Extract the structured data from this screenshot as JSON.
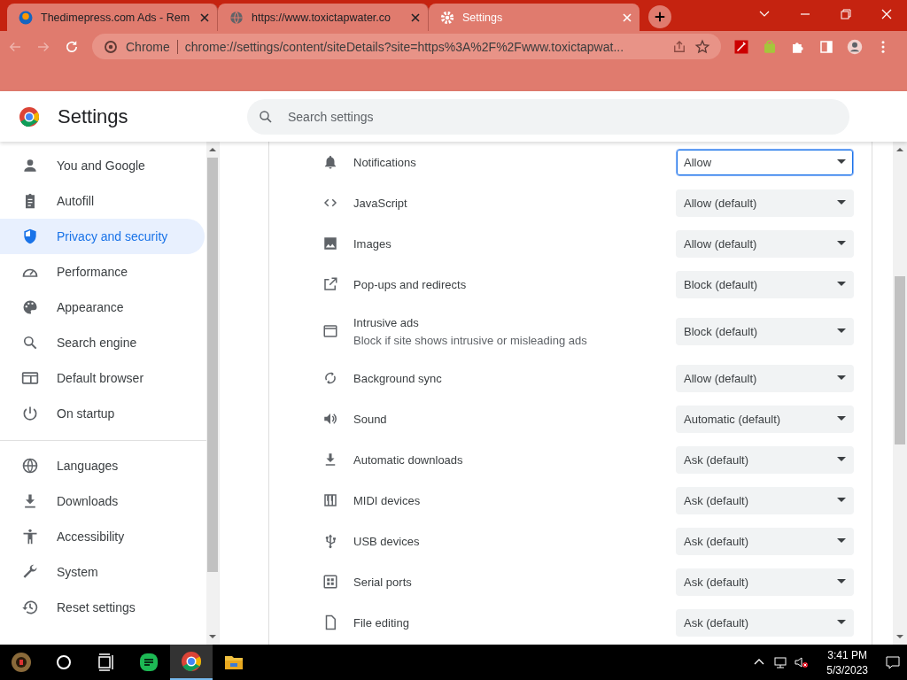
{
  "browser": {
    "tabs": [
      {
        "title": "Thedimepress.com Ads - Rem",
        "selected": false
      },
      {
        "title": "https://www.toxictapwater.co",
        "selected": false
      },
      {
        "title": "Settings",
        "selected": true
      }
    ],
    "omnibox": {
      "chip": "Chrome",
      "url": "chrome://settings/content/siteDetails?site=https%3A%2F%2Fwww.toxictapwat..."
    }
  },
  "header": {
    "title": "Settings",
    "search": {
      "placeholder": "Search settings"
    }
  },
  "sidebar": {
    "groups": [
      [
        {
          "label": "You and Google",
          "selected": false
        },
        {
          "label": "Autofill",
          "selected": false
        },
        {
          "label": "Privacy and security",
          "selected": true
        },
        {
          "label": "Performance",
          "selected": false
        },
        {
          "label": "Appearance",
          "selected": false
        },
        {
          "label": "Search engine",
          "selected": false
        },
        {
          "label": "Default browser",
          "selected": false
        },
        {
          "label": "On startup",
          "selected": false
        }
      ],
      [
        {
          "label": "Languages",
          "selected": false
        },
        {
          "label": "Downloads",
          "selected": false
        },
        {
          "label": "Accessibility",
          "selected": false
        },
        {
          "label": "System",
          "selected": false
        },
        {
          "label": "Reset settings",
          "selected": false
        }
      ]
    ]
  },
  "permissions": [
    {
      "label": "Notifications",
      "value": "Allow",
      "focused": true
    },
    {
      "label": "JavaScript",
      "value": "Allow (default)",
      "focused": false
    },
    {
      "label": "Images",
      "value": "Allow (default)",
      "focused": false
    },
    {
      "label": "Pop-ups and redirects",
      "value": "Block (default)",
      "focused": false
    },
    {
      "label": "Intrusive ads",
      "description": "Block if site shows intrusive or misleading ads",
      "value": "Block (default)",
      "focused": false
    },
    {
      "label": "Background sync",
      "value": "Allow (default)",
      "focused": false
    },
    {
      "label": "Sound",
      "value": "Automatic (default)",
      "focused": false
    },
    {
      "label": "Automatic downloads",
      "value": "Ask (default)",
      "focused": false
    },
    {
      "label": "MIDI devices",
      "value": "Ask (default)",
      "focused": false
    },
    {
      "label": "USB devices",
      "value": "Ask (default)",
      "focused": false
    },
    {
      "label": "Serial ports",
      "value": "Ask (default)",
      "focused": false
    },
    {
      "label": "File editing",
      "value": "Ask (default)",
      "focused": false
    }
  ],
  "taskbar": {
    "time": "3:41 PM",
    "date": "5/3/2023"
  }
}
